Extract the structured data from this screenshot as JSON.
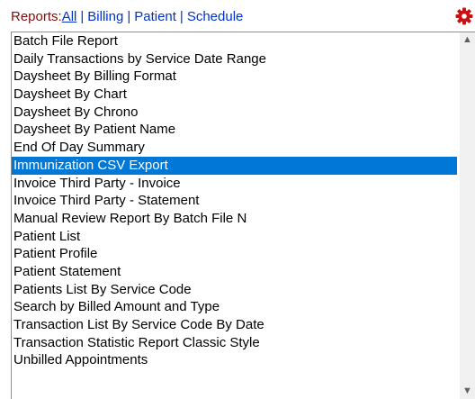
{
  "header": {
    "label": "Reports:",
    "filters": [
      {
        "label": "All",
        "active": true
      },
      {
        "label": "Billing",
        "active": false
      },
      {
        "label": "Patient",
        "active": false
      },
      {
        "label": "Schedule",
        "active": false
      }
    ],
    "separator": "|",
    "settings_icon": "gear-icon"
  },
  "report_list": {
    "selected_index": 7,
    "items": [
      "Batch File Report",
      "Daily Transactions by Service Date Range",
      "Daysheet By Billing Format",
      "Daysheet By Chart",
      "Daysheet By Chrono",
      "Daysheet By Patient Name",
      "End Of Day Summary",
      "Immunization CSV Export",
      "Invoice Third Party - Invoice",
      "Invoice Third Party - Statement",
      "Manual Review Report By Batch File N",
      "Patient List",
      "Patient Profile",
      "Patient Statement",
      "Patients List By Service Code",
      "Search by Billed Amount and Type",
      "Transaction List By Service Code By Date",
      "Transaction Statistic Report Classic Style",
      "Unbilled Appointments"
    ]
  },
  "scrollbar": {
    "up_arrow": "▲",
    "down_arrow": "▼"
  },
  "colors": {
    "selection": "#0078d7",
    "link": "#0033cc",
    "label": "#7a1010",
    "gear": "#cc1111"
  }
}
